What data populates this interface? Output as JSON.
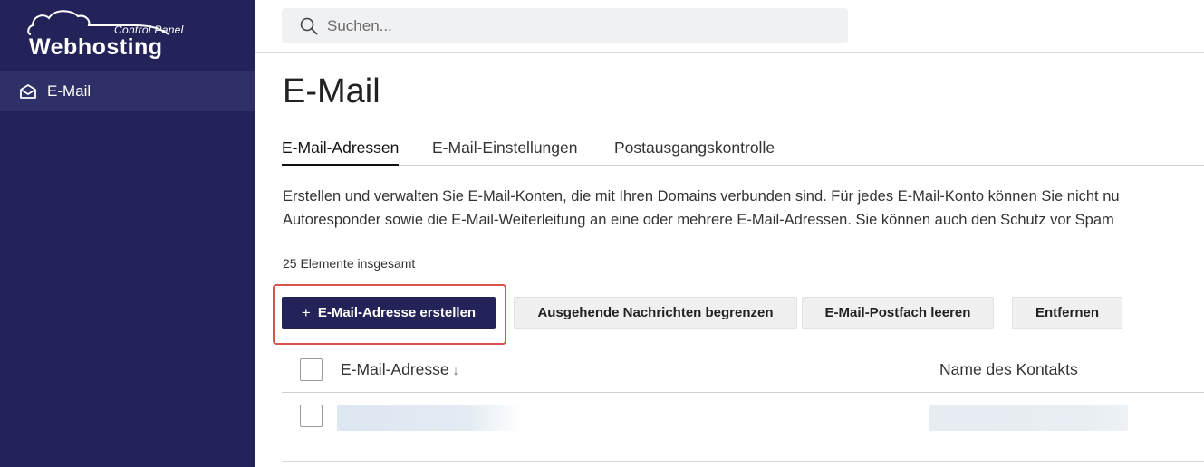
{
  "brand": {
    "subtitle": "Control Panel",
    "name": "Webhosting"
  },
  "sidebar": {
    "items": [
      {
        "label": "E-Mail",
        "icon": "envelope-open-icon",
        "active": true
      }
    ]
  },
  "search": {
    "placeholder": "Suchen..."
  },
  "page": {
    "title": "E-Mail"
  },
  "tabs": [
    {
      "label": "E-Mail-Adressen",
      "active": true
    },
    {
      "label": "E-Mail-Einstellungen",
      "active": false
    },
    {
      "label": "Postausgangskontrolle",
      "active": false
    }
  ],
  "description": {
    "line1": "Erstellen und verwalten Sie E-Mail-Konten, die mit Ihren Domains verbunden sind. Für jedes E-Mail-Konto können Sie nicht nu",
    "line2": "Autoresponder sowie die E-Mail-Weiterleitung an eine oder mehrere E-Mail-Adressen. Sie können auch den Schutz vor Spam"
  },
  "list": {
    "count_label": "25 Elemente insgesamt"
  },
  "toolbar": {
    "create_plus": "+",
    "create_label": "E-Mail-Adresse erstellen",
    "limit_label": "Ausgehende Nachrichten begrenzen",
    "empty_label": "E-Mail-Postfach leeren",
    "remove_label": "Entfernen"
  },
  "table": {
    "columns": [
      {
        "label": "E-Mail-Adresse",
        "sort": "↓"
      },
      {
        "label": "Name des Kontakts"
      }
    ]
  },
  "colors": {
    "sidebar_bg": "#23235a",
    "primary_button": "#23235a",
    "highlight_border": "#d9534f"
  }
}
